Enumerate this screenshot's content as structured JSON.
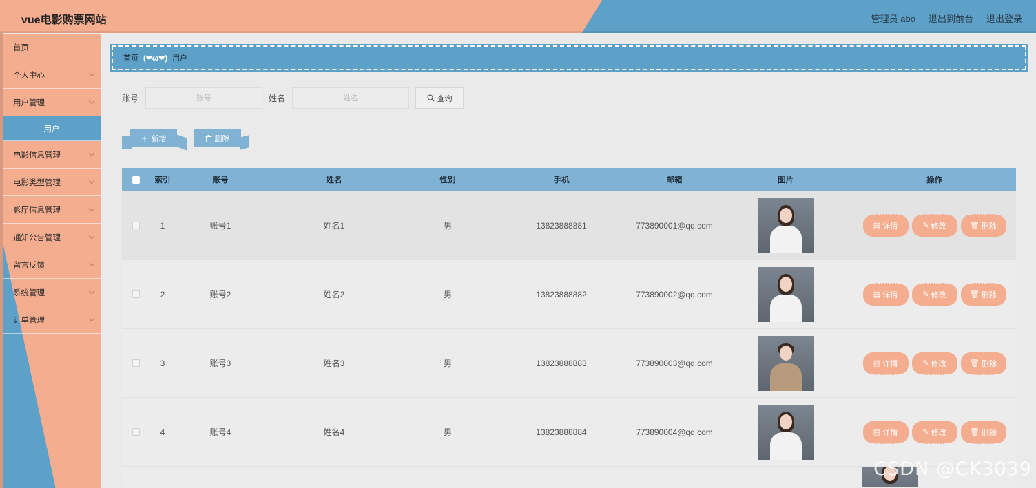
{
  "header": {
    "title": "vue电影购票网站",
    "admin": "管理员 abo",
    "to_front": "退出到前台",
    "logout": "退出登录"
  },
  "sidebar": {
    "items": [
      {
        "label": "首页",
        "expandable": false
      },
      {
        "label": "个人中心",
        "expandable": true
      },
      {
        "label": "用户管理",
        "expandable": true
      },
      {
        "label": "用户",
        "sub": true,
        "active": true
      },
      {
        "label": "电影信息管理",
        "expandable": true
      },
      {
        "label": "电影类型管理",
        "expandable": true
      },
      {
        "label": "影厅信息管理",
        "expandable": true
      },
      {
        "label": "通知公告管理",
        "expandable": true
      },
      {
        "label": "留言反馈",
        "expandable": true
      },
      {
        "label": "系统管理",
        "expandable": true
      },
      {
        "label": "订单管理",
        "expandable": true
      }
    ]
  },
  "breadcrumb": {
    "home": "首页",
    "separator": "(❤ω❤)",
    "current": "用户"
  },
  "search": {
    "account_label": "账号",
    "account_placeholder": "账号",
    "name_label": "姓名",
    "name_placeholder": "姓名",
    "query_label": "查询"
  },
  "actions": {
    "add_label": "新增",
    "delete_label": "删除"
  },
  "table": {
    "headers": {
      "index": "索引",
      "account": "账号",
      "name": "姓名",
      "gender": "性别",
      "phone": "手机",
      "email": "邮箱",
      "image": "图片",
      "operation": "操作"
    },
    "rows": [
      {
        "index": "1",
        "account": "账号1",
        "name": "姓名1",
        "gender": "男",
        "phone": "13823888881",
        "email": "773890001@qq.com",
        "photo": "female"
      },
      {
        "index": "2",
        "account": "账号2",
        "name": "姓名2",
        "gender": "男",
        "phone": "13823888882",
        "email": "773890002@qq.com",
        "photo": "female"
      },
      {
        "index": "3",
        "account": "账号3",
        "name": "姓名3",
        "gender": "男",
        "phone": "13823888883",
        "email": "773890003@qq.com",
        "photo": "male"
      },
      {
        "index": "4",
        "account": "账号4",
        "name": "姓名4",
        "gender": "男",
        "phone": "13823888884",
        "email": "773890004@qq.com",
        "photo": "female"
      }
    ],
    "row_actions": {
      "detail": "详情",
      "edit": "修改",
      "delete": "删除"
    }
  },
  "watermark": "CSDN @CK3039",
  "colors": {
    "accent_orange": "#f4ad8f",
    "accent_blue": "#5ea1c8",
    "table_header": "#7fb2d3"
  }
}
